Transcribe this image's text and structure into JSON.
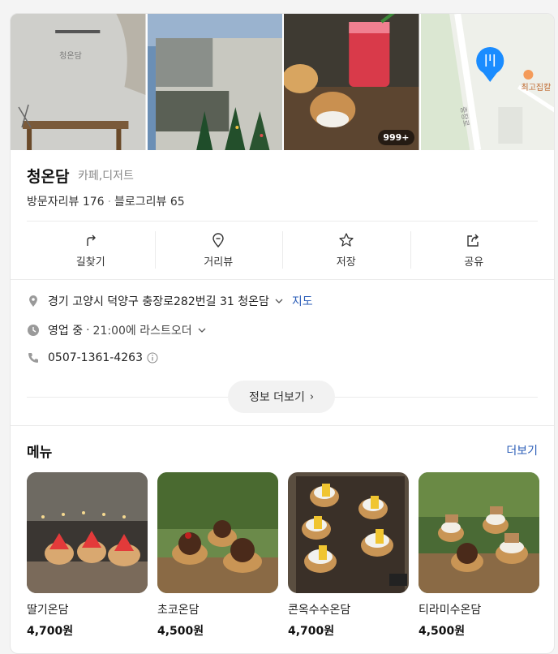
{
  "place": {
    "name": "청온담",
    "category": "카페,디저트",
    "visitor_reviews": "방문자리뷰 176",
    "blog_reviews": "블로그리뷰 65",
    "photo_count_badge": "999+",
    "map_label": "최고집칼",
    "map_road_label": "중장로"
  },
  "actions": [
    {
      "label": "길찾기",
      "icon": "directions-icon"
    },
    {
      "label": "거리뷰",
      "icon": "streetview-icon"
    },
    {
      "label": "저장",
      "icon": "star-icon"
    },
    {
      "label": "공유",
      "icon": "share-icon"
    }
  ],
  "info": {
    "address": "경기 고양시 덕양구 충장로282번길 31 청온담",
    "map_link": "지도",
    "status": "영업 중",
    "hours": "21:00에 라스트오더",
    "phone": "0507-1361-4263"
  },
  "more_info_label": "정보 더보기",
  "menu": {
    "title": "메뉴",
    "more_label": "더보기",
    "items": [
      {
        "name": "딸기온담",
        "price": "4,700원"
      },
      {
        "name": "초코온담",
        "price": "4,500원"
      },
      {
        "name": "콘옥수수온담",
        "price": "4,700원"
      },
      {
        "name": "티라미수온담",
        "price": "4,500원"
      }
    ]
  },
  "colors": {
    "link": "#2a5cb7",
    "map_pin": "#1a8cff"
  }
}
